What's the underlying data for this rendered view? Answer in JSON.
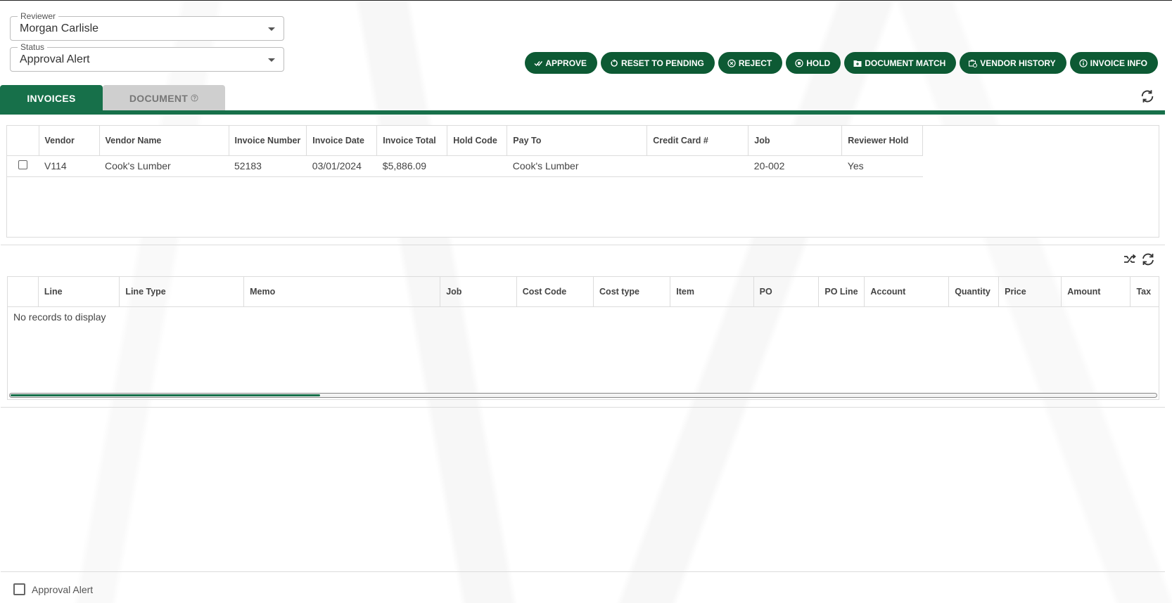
{
  "reviewer": {
    "legend": "Reviewer",
    "value": "Morgan Carlisle"
  },
  "status": {
    "legend": "Status",
    "value": "Approval Alert"
  },
  "actions": [
    {
      "label": "APPROVE",
      "icon": "check-double-icon"
    },
    {
      "label": "RESET TO PENDING",
      "icon": "reset-icon"
    },
    {
      "label": "REJECT",
      "icon": "x-circle-icon"
    },
    {
      "label": "HOLD",
      "icon": "stop-circle-icon"
    },
    {
      "label": "DOCUMENT MATCH",
      "icon": "folder-plus-icon"
    },
    {
      "label": "VENDOR HISTORY",
      "icon": "briefcase-clock-icon"
    },
    {
      "label": "INVOICE INFO",
      "icon": "info-icon"
    }
  ],
  "tabs": {
    "invoices": "INVOICES",
    "document": "DOCUMENT"
  },
  "invoices_table": {
    "headers": [
      "Vendor",
      "Vendor Name",
      "Invoice Number",
      "Invoice Date",
      "Invoice Total",
      "Hold Code",
      "Pay To",
      "Credit Card #",
      "Job",
      "Reviewer Hold"
    ],
    "rows": [
      {
        "vendor": "V114",
        "vendor_name": "Cook's Lumber",
        "invoice_number": "52183",
        "invoice_date": "03/01/2024",
        "invoice_total": "$5,886.09",
        "hold_code": "",
        "pay_to": "Cook's Lumber",
        "credit_card": "",
        "job": "20-002",
        "reviewer_hold": "Yes"
      }
    ]
  },
  "lines_table": {
    "headers": [
      "Line",
      "Line Type",
      "Memo",
      "Job",
      "Cost Code",
      "Cost type",
      "Item",
      "PO",
      "PO Line",
      "Account",
      "Quantity",
      "Price",
      "Amount",
      "Tax"
    ],
    "empty_text": "No records to display",
    "scroll_fraction": 0.27
  },
  "footer": {
    "checkbox_label": "Approval Alert"
  },
  "colors": {
    "accent": "#17704a",
    "button": "#0d5a34"
  }
}
